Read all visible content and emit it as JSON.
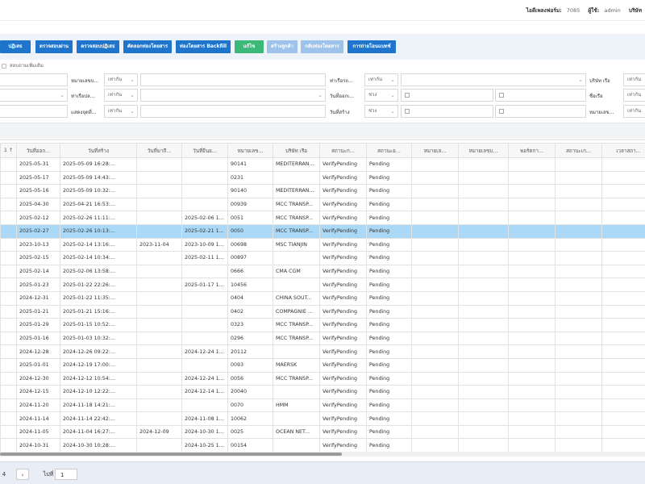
{
  "header": {
    "db_label": "ไอดีเพลงฟอร์ม:",
    "db_value": "7085",
    "user_label": "ผู้ใช้:",
    "user_value": "admin",
    "extra_label": "บริษัท"
  },
  "toolbar": {
    "buttons": [
      {
        "label": "ปฏิเสธ"
      },
      {
        "label": "ตรวจสอบผ่าน"
      },
      {
        "label": "ตรวจสอบปฏิเสธ"
      },
      {
        "label": "คัดลอกท่องโดยสาร"
      },
      {
        "label": "ท่องโดยสาร Backfill"
      },
      {
        "label": "แก้ไข"
      },
      {
        "label": "สร้างลูกค้า"
      },
      {
        "label": "กลับท่องโดยสาร"
      },
      {
        "label": "การถ่ายโอนแบทช์"
      }
    ]
  },
  "filters": {
    "checkbox_label": "สอบถามเพิ่มเติม",
    "row1": {
      "f1_label": "หมายเลขบ...",
      "f1_op": "เท่ากัน",
      "f2_label": "ท่าเรือรถ...",
      "f2_op": "เท่ากัน",
      "f3_label": "บริษัท เรือ",
      "f3_op": "เท่ากัน"
    },
    "row2": {
      "f1_label": "ท่าเรือปล...",
      "f1_op": "เท่ากัน",
      "f2_label": "วันที่ออกเ...",
      "f2_op": "ช่วง",
      "f3_label": "ชื่อเรือ",
      "f3_op": "เท่ากัน"
    },
    "row3": {
      "f1_label": "แสดงจุดที่...",
      "f1_op": "เท่ากัน",
      "f2_label": "วันที่สร้าง",
      "f2_op": "ช่วง",
      "f3_label": "หมายเลข...",
      "f3_op": "เท่ากัน"
    }
  },
  "table": {
    "columns": [
      "1 ↑",
      "วันที่ออก...",
      "วันที่สร้าง",
      "วันที่มาถึ...",
      "วันที่ยืนย...",
      "หมายเลข...",
      "บริษัท เรือ",
      "สถานะก...",
      "สถานะอ...",
      "หมายเล...",
      "หมายเลขบ...",
      "พอร์ตกา...",
      "สถานะเก...",
      "เวลาสถา..."
    ],
    "rows": [
      [
        "",
        "2025-05-31",
        "2025-05-09 16:28:...",
        "",
        "",
        "90141",
        "MEDITERRAN...",
        "VerifyPending",
        "Pending",
        "",
        "",
        "",
        "",
        ""
      ],
      [
        "",
        "2025-05-17",
        "2025-05-09 14:43:...",
        "",
        "",
        "0231",
        "",
        "VerifyPending",
        "Pending",
        "",
        "",
        "",
        "",
        ""
      ],
      [
        "",
        "2025-05-16",
        "2025-05-09 10:32:...",
        "",
        "",
        "90140",
        "MEDITERRAN...",
        "VerifyPending",
        "Pending",
        "",
        "",
        "",
        "",
        ""
      ],
      [
        "",
        "2025-04-30",
        "2025-04-21 16:53:...",
        "",
        "",
        "00939",
        "MCC TRANSP...",
        "VerifyPending",
        "Pending",
        "",
        "",
        "",
        "",
        ""
      ],
      [
        "",
        "2025-02-12",
        "2025-02-26 11:11:...",
        "",
        "2025-02-06 1...",
        "0051",
        "MCC TRANSP...",
        "VerifyPending",
        "Pending",
        "",
        "",
        "",
        "",
        ""
      ],
      [
        "",
        "2025-02-27",
        "2025-02-26 10:13:...",
        "",
        "2025-02-21 1...",
        "0050",
        "MCC TRANSP...",
        "VerifyPending",
        "Pending",
        "",
        "",
        "",
        "",
        ""
      ],
      [
        "",
        "2023-10-13",
        "2025-02-14 13:16:...",
        "2023-11-04",
        "2023-10-09 1...",
        "00698",
        "MSC TIANJIN",
        "VerifyPending",
        "Pending",
        "",
        "",
        "",
        "",
        ""
      ],
      [
        "",
        "2025-02-15",
        "2025-02-14 10:34:...",
        "",
        "2025-02-11 1...",
        "00897",
        "",
        "VerifyPending",
        "Pending",
        "",
        "",
        "",
        "",
        ""
      ],
      [
        "",
        "2025-02-14",
        "2025-02-06 13:58:...",
        "",
        "",
        "0666",
        "CMA CGM",
        "VerifyPending",
        "Pending",
        "",
        "",
        "",
        "",
        ""
      ],
      [
        "",
        "2025-01-23",
        "2025-01-22 22:26:...",
        "",
        "2025-01-17 1...",
        "10456",
        "",
        "VerifyPending",
        "Pending",
        "",
        "",
        "",
        "",
        ""
      ],
      [
        "",
        "2024-12-31",
        "2025-01-22 11:35:...",
        "",
        "",
        "0404",
        "CHINA SOUT...",
        "VerifyPending",
        "Pending",
        "",
        "",
        "",
        "",
        ""
      ],
      [
        "",
        "2025-01-21",
        "2025-01-21 15:16:...",
        "",
        "",
        "0402",
        "COMPAGNIE ...",
        "VerifyPending",
        "Pending",
        "",
        "",
        "",
        "",
        ""
      ],
      [
        "",
        "2025-01-29",
        "2025-01-15 10:52:...",
        "",
        "",
        "0323",
        "MCC TRANSP...",
        "VerifyPending",
        "Pending",
        "",
        "",
        "",
        "",
        ""
      ],
      [
        "",
        "2025-01-16",
        "2025-01-03 10:32:...",
        "",
        "",
        "0296",
        "MCC TRANSP...",
        "VerifyPending",
        "Pending",
        "",
        "",
        "",
        "",
        ""
      ],
      [
        "",
        "2024-12-28",
        "2024-12-26 09:22:...",
        "",
        "2024-12-24 1...",
        "20112",
        "",
        "VerifyPending",
        "Pending",
        "",
        "",
        "",
        "",
        ""
      ],
      [
        "",
        "2025-01-01",
        "2024-12-19 17:00:...",
        "",
        "",
        "0093",
        "MAERSK",
        "VerifyPending",
        "Pending",
        "",
        "",
        "",
        "",
        ""
      ],
      [
        "",
        "2024-12-30",
        "2024-12-12 10:54:...",
        "",
        "2024-12-24 1...",
        "0056",
        "MCC TRANSP...",
        "VerifyPending",
        "Pending",
        "",
        "",
        "",
        "",
        ""
      ],
      [
        "",
        "2024-12-15",
        "2024-12-10 12:22:...",
        "",
        "2024-12-14 1...",
        "20040",
        "",
        "VerifyPending",
        "Pending",
        "",
        "",
        "",
        "",
        ""
      ],
      [
        "",
        "2024-11-20",
        "2024-11-18 14:21:...",
        "",
        "",
        "0070",
        "HMM",
        "VerifyPending",
        "Pending",
        "",
        "",
        "",
        "",
        ""
      ],
      [
        "",
        "2024-11-14",
        "2024-11-14 22:42:...",
        "",
        "2024-11-08 1...",
        "10062",
        "",
        "VerifyPending",
        "Pending",
        "",
        "",
        "",
        "",
        ""
      ],
      [
        "",
        "2024-11-05",
        "2024-11-04 16:27:...",
        "2024-12-09",
        "2024-10-30 1...",
        "0025",
        "OCEAN NET...",
        "VerifyPending",
        "Pending",
        "",
        "",
        "",
        "",
        ""
      ],
      [
        "",
        "2024-10-31",
        "2024-10-30 10:28:...",
        "",
        "2024-10-25 1...",
        "00154",
        "",
        "VerifyPending",
        "Pending",
        "",
        "",
        "",
        "",
        ""
      ]
    ],
    "selected_row": 5
  },
  "footer": {
    "page_prev": "4",
    "next_glyph": "›",
    "goto_label": "ไปที่",
    "goto_value": "1"
  }
}
